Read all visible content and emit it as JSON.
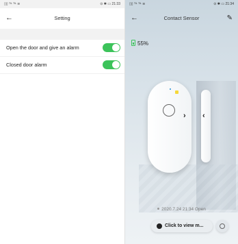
{
  "left": {
    "status": {
      "left": "▯▯ ᵀᴵᴸ ᵀᴵᴸ ≋",
      "right": "⊙ ✱ ▭ 21:33"
    },
    "header": {
      "back_icon": "arrow-left-icon",
      "title": "Setting"
    },
    "settings": [
      {
        "label": "Open the door and give an alarm",
        "enabled": true
      },
      {
        "label": "Closed door alarm",
        "enabled": true
      }
    ]
  },
  "right": {
    "status": {
      "left": "▯▯ ᵀᴵᴸ ᵀᴵᴸ ≋",
      "right": "⊙ ✱ ▭ 21:34"
    },
    "header": {
      "back_icon": "arrow-left-icon",
      "title": "Contact Sensor",
      "edit_icon": "pencil-icon"
    },
    "battery": "55%",
    "log_entry": "2020.7.24 21:34 Open",
    "view_button": "Click to view m...",
    "colors": {
      "toggle_on": "#3cc35a",
      "battery": "#3cc35a",
      "led": "#f6d83a"
    }
  }
}
